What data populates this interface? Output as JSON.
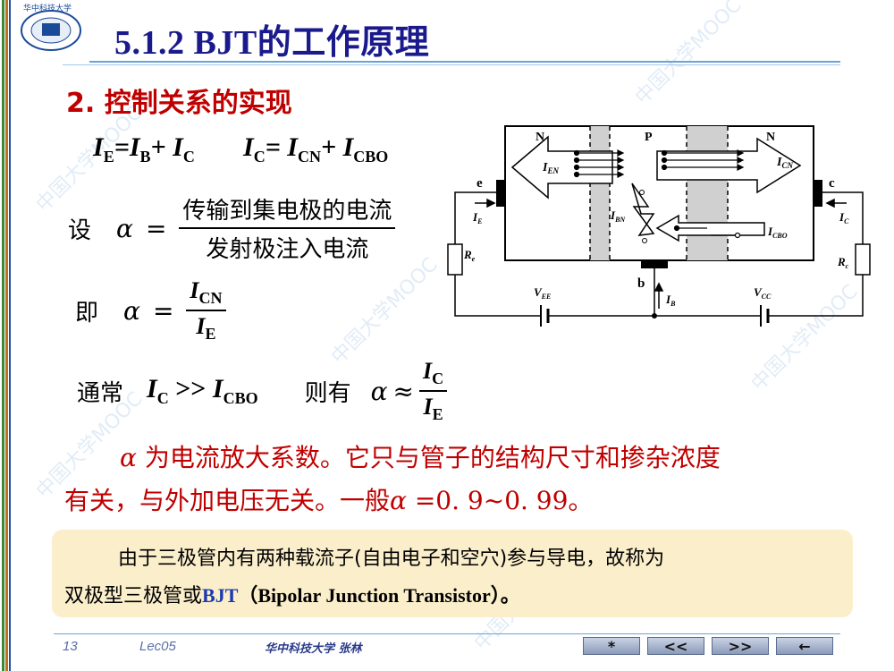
{
  "header": {
    "title": "5.1.2  BJT的工作原理",
    "logo_text": "华中科技大学"
  },
  "section": {
    "title": "2. 控制关系的实现"
  },
  "equations": {
    "eq1": {
      "left": "I",
      "sub_e": "E",
      "eq": "=",
      "ib": "I",
      "sub_b": "B",
      "plus": "+ ",
      "ic": "I",
      "sub_c": "C"
    },
    "eq2": {
      "ic": "I",
      "sub_c": "C",
      "eq": "= ",
      "icn": "I",
      "sub_cn": "CN",
      "plus": "+ ",
      "icbo": "I",
      "sub_cbo": "CBO"
    },
    "set_label": "设",
    "alpha": "α",
    "equals": "=",
    "frac1_num": "传输到集电极的电流",
    "frac1_den": "发射极注入电流",
    "ji_label": "即",
    "frac2_num": "I",
    "frac2_num_sub": "CN",
    "frac2_den": "I",
    "frac2_den_sub": "E",
    "usual_label": "通常",
    "cond_ic": "I",
    "cond_ic_sub": "C",
    "cond_gg": " >> ",
    "cond_icbo": "I",
    "cond_icbo_sub": "CBO",
    "then_label": "则有",
    "approx": "≈",
    "frac3_num": "I",
    "frac3_num_sub": "C",
    "frac3_den": "I",
    "frac3_den_sub": "E"
  },
  "paragraph": {
    "line1_alpha": "α",
    "line1": " 为电流放大系数。它只与管子的结构尺寸和掺杂浓度",
    "line2_a": "有关，与外加电压无关。一般",
    "line2_alpha": "α",
    "line2_b": " =0. 9~0. 99。"
  },
  "note": {
    "line1": "由于三极管内有两种载流子(自由电子和空穴)参与导电，故称为",
    "line2_a": "双极型三极管或",
    "line2_bjt": "BJT",
    "line2_b": "（Bipolar Junction Transistor）。"
  },
  "diagram": {
    "n_left": "N",
    "p_mid": "P",
    "n_right": "N",
    "e": "e",
    "c": "c",
    "b": "b",
    "ien": "I",
    "ien_sub": "EN",
    "icn": "I",
    "icn_sub": "CN",
    "ibn": "I",
    "ibn_sub": "BN",
    "icbo": "I",
    "icbo_sub": "CBO",
    "ie": "I",
    "ie_sub": "E",
    "ic": "I",
    "ic_sub": "C",
    "ib": "I",
    "ib_sub": "B",
    "re": "R",
    "re_sub": "e",
    "rc": "R",
    "rc_sub": "c",
    "vee": "V",
    "vee_sub": "EE",
    "vcc": "V",
    "vcc_sub": "CC"
  },
  "footer": {
    "page": "13",
    "lecture": "Lec05",
    "author": "华中科技大学   张林",
    "nav": [
      "*",
      "<<",
      ">>",
      "←"
    ]
  },
  "watermark": "中国大学MOOC",
  "colors": {
    "title": "#1a1a8c",
    "section": "#c00000",
    "note_bg": "#fbeecb",
    "rule": "#6aa3d8"
  }
}
